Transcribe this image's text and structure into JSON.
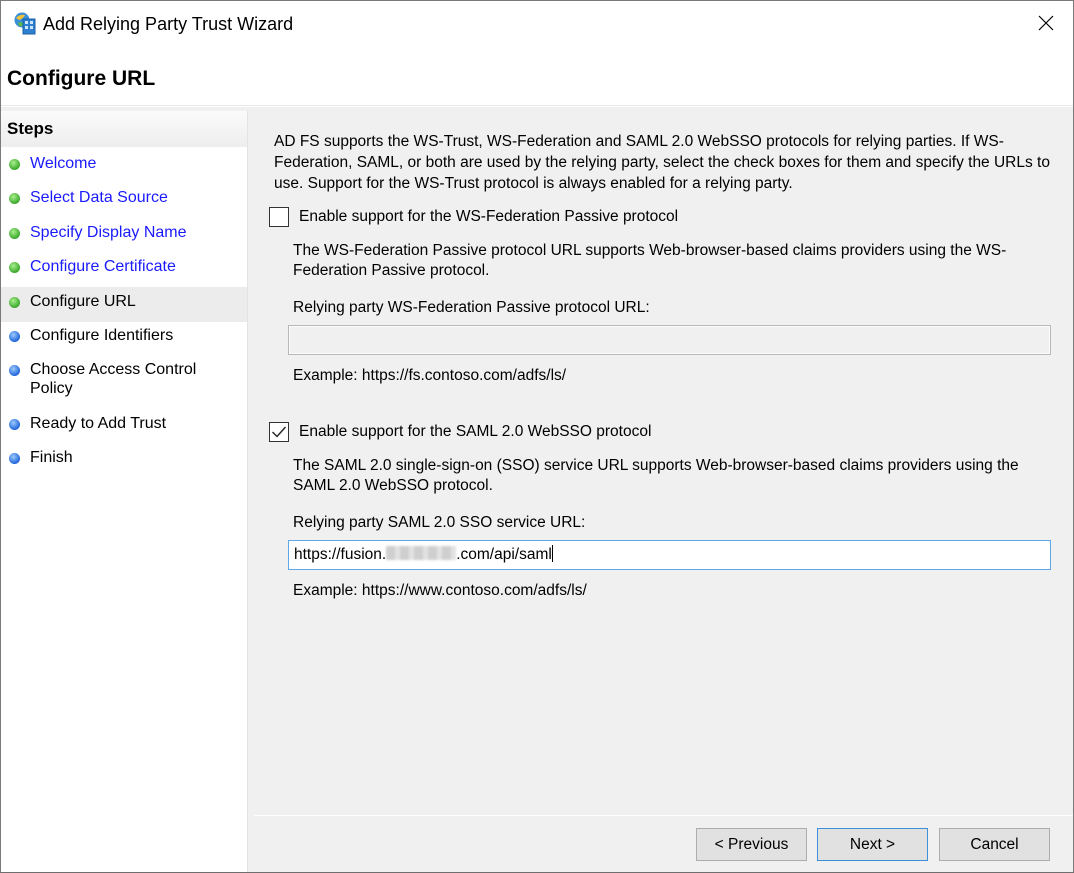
{
  "window": {
    "title": "Add Relying Party Trust Wizard",
    "icon": "adfs-wizard-icon",
    "close_icon": "close-icon"
  },
  "header": {
    "title": "Configure URL"
  },
  "sidebar": {
    "heading": "Steps",
    "items": [
      {
        "label": "Welcome",
        "status": "completed"
      },
      {
        "label": "Select Data Source",
        "status": "completed"
      },
      {
        "label": "Specify Display Name",
        "status": "completed"
      },
      {
        "label": "Configure Certificate",
        "status": "completed"
      },
      {
        "label": "Configure URL",
        "status": "current"
      },
      {
        "label": "Configure Identifiers",
        "status": "pending"
      },
      {
        "label": "Choose Access Control Policy",
        "status": "pending"
      },
      {
        "label": "Ready to Add Trust",
        "status": "pending"
      },
      {
        "label": "Finish",
        "status": "pending"
      }
    ]
  },
  "main": {
    "intro": "AD FS supports the WS-Trust, WS-Federation and SAML 2.0 WebSSO protocols for relying parties.  If WS-Federation, SAML, or both are used by the relying party, select the check boxes for them and specify the URLs to use.  Support for the WS-Trust protocol is always enabled for a relying party.",
    "wsfed": {
      "checkbox_label": "Enable support for the WS-Federation Passive protocol",
      "checked": false,
      "description": "The WS-Federation Passive protocol URL supports Web-browser-based claims providers using the WS-Federation Passive protocol.",
      "field_label": "Relying party WS-Federation Passive protocol URL:",
      "value": "",
      "example": "Example: https://fs.contoso.com/adfs/ls/"
    },
    "saml": {
      "checkbox_label": "Enable support for the SAML 2.0 WebSSO protocol",
      "checked": true,
      "description": "The SAML 2.0 single-sign-on (SSO) service URL supports Web-browser-based claims providers using the SAML 2.0 WebSSO protocol.",
      "field_label": "Relying party SAML 2.0 SSO service URL:",
      "value_prefix": "https://fusion.",
      "value_suffix": ".com/api/saml",
      "example": "Example: https://www.contoso.com/adfs/ls/"
    }
  },
  "footer": {
    "previous_label": "< Previous",
    "next_label": "Next >",
    "cancel_label": "Cancel"
  },
  "colors": {
    "completed_link": "#1a1aff",
    "completed_dot": "#3ba82b",
    "pending_dot": "#1f65d9",
    "focus_border": "#5ea7e8",
    "background": "#f0f0f0"
  }
}
